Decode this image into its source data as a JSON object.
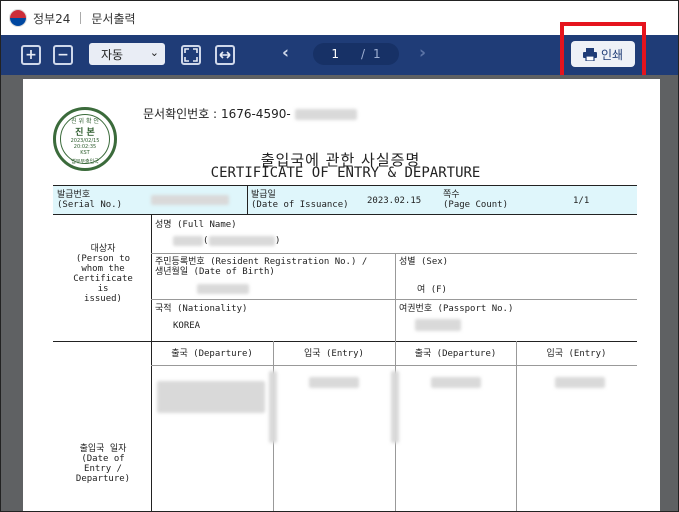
{
  "app": {
    "brand": "정부24",
    "window_title": "문서출력"
  },
  "toolbar": {
    "zoom_in": "+",
    "zoom_out": "−",
    "zoom_value": "자동",
    "current_page": "1",
    "page_separator": "/",
    "total_pages": "1",
    "print_label": "인쇄"
  },
  "document": {
    "doc_number_label": "문서확인번호 :",
    "doc_number_visible": "1676-4590-",
    "seal": {
      "top": "진 위 확 인",
      "main": "진 본",
      "date": "2023/02/15",
      "time": "20:02:35",
      "zone": "KST",
      "bottom": "법무부출입국"
    },
    "title_ko": "출입국에 관한 사실증명",
    "title_en": "CERTIFICATE OF ENTRY & DEPARTURE",
    "serial_label_ko": "발급번호",
    "serial_label_en": "(Serial No.)",
    "issue_label_ko": "발급일",
    "issue_label_en": "(Date of Issuance)",
    "issue_date": "2023.02.15",
    "page_label_ko": "쪽수",
    "page_label_en": "(Page Count)",
    "page_count": "1/1",
    "subject_label": [
      "대상자",
      "(Person to",
      "whom the",
      "Certificate",
      "is",
      "issued)"
    ],
    "fullname_label": "성명 (Full Name)",
    "reg_label_1": "주민등록번호 (Resident Registration No.) /",
    "reg_label_2": "생년월일 (Date of Birth)",
    "sex_label": "성별 (Sex)",
    "sex_value": "여 (F)",
    "nationality_label": "국적 (Nationality)",
    "nationality_value": "KOREA",
    "passport_label": "여권번호 (Passport No.)",
    "entry_label": [
      "출입국 일자",
      "(Date of",
      "Entry /",
      "Departure)"
    ],
    "col_departure": "출국 (Departure)",
    "col_entry": "입국 (Entry)",
    "col_departure_2": "출국 (Departure)",
    "col_entry_2": "입국 (Entry)"
  }
}
